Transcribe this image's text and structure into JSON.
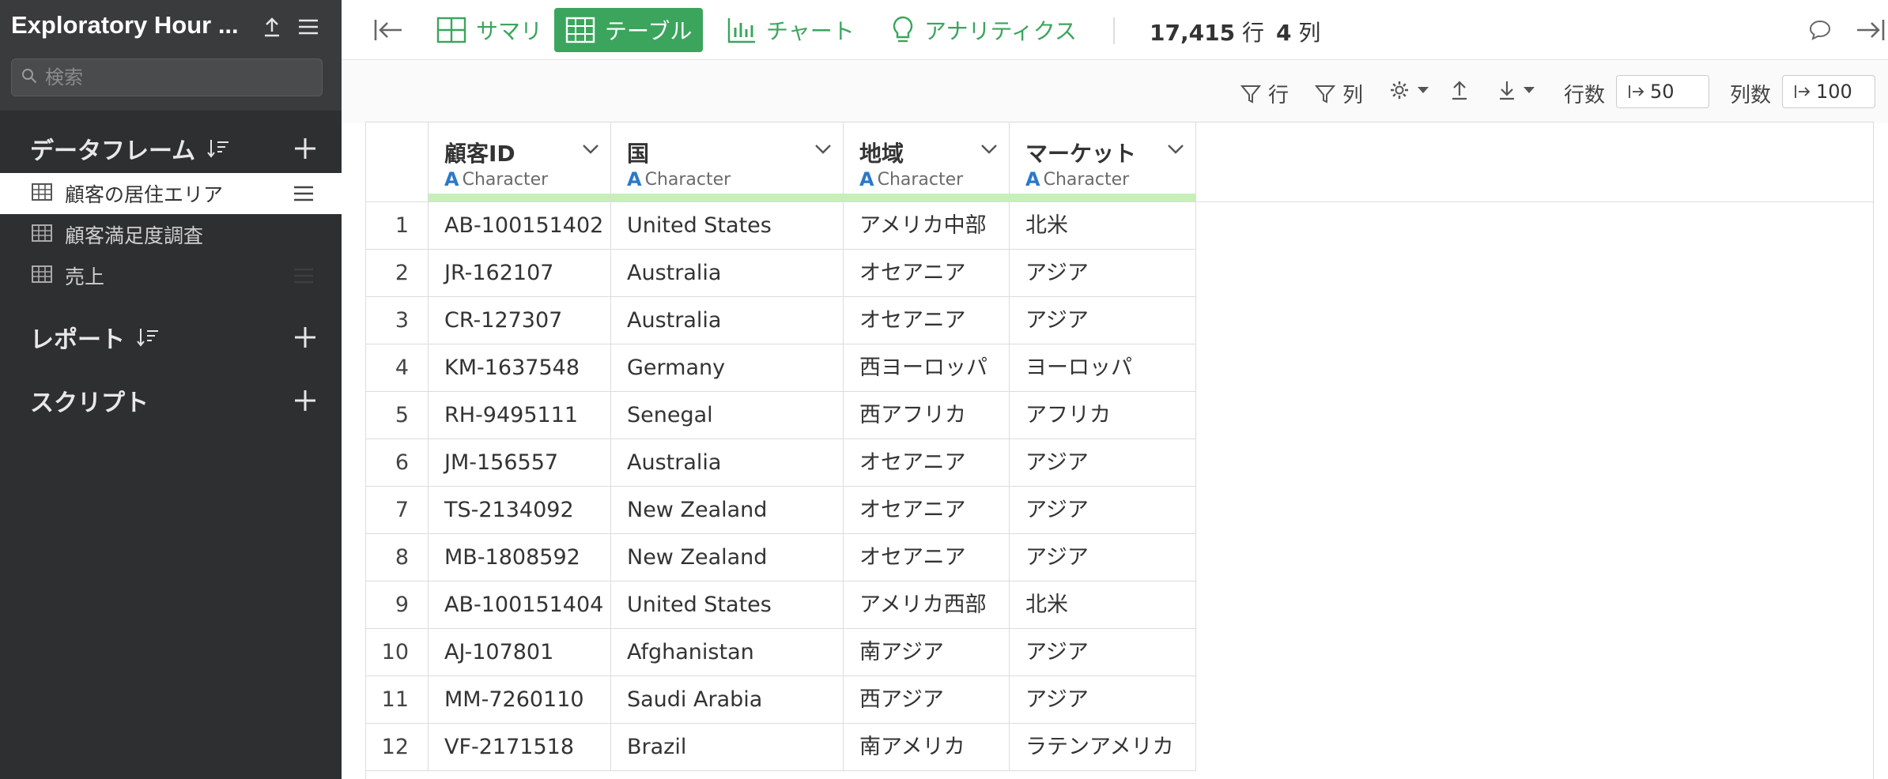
{
  "sidebar": {
    "project_title": "Exploratory Hour ...",
    "search_placeholder": "検索",
    "sections": {
      "dataframes": "データフレーム",
      "reports": "レポート",
      "scripts": "スクリプト"
    },
    "dataframes": [
      {
        "label": "顧客の居住エリア",
        "active": true
      },
      {
        "label": "顧客満足度調査",
        "active": false
      },
      {
        "label": "売上",
        "active": false
      }
    ]
  },
  "topbar": {
    "tabs": {
      "summary": "サマリ",
      "table": "テーブル",
      "chart": "チャート",
      "analytics": "アナリティクス"
    },
    "rows_count": "17,415",
    "rows_unit": "行",
    "cols_count": "4",
    "cols_unit": "列"
  },
  "toolbar": {
    "filter_rows": "行",
    "filter_cols": "列",
    "rows_label": "行数",
    "rows_value": "50",
    "cols_label": "列数",
    "cols_value": "100"
  },
  "table": {
    "columns": [
      {
        "name": "顧客ID",
        "type": "Character"
      },
      {
        "name": "国",
        "type": "Character"
      },
      {
        "name": "地域",
        "type": "Character"
      },
      {
        "name": "マーケット",
        "type": "Character"
      }
    ],
    "rows": [
      {
        "idx": "1",
        "c0": "AB-100151402",
        "c1": "United States",
        "c2": "アメリカ中部",
        "c3": "北米"
      },
      {
        "idx": "2",
        "c0": "JR-162107",
        "c1": "Australia",
        "c2": "オセアニア",
        "c3": "アジア"
      },
      {
        "idx": "3",
        "c0": "CR-127307",
        "c1": "Australia",
        "c2": "オセアニア",
        "c3": "アジア"
      },
      {
        "idx": "4",
        "c0": "KM-1637548",
        "c1": "Germany",
        "c2": "西ヨーロッパ",
        "c3": "ヨーロッパ"
      },
      {
        "idx": "5",
        "c0": "RH-9495111",
        "c1": "Senegal",
        "c2": "西アフリカ",
        "c3": "アフリカ"
      },
      {
        "idx": "6",
        "c0": "JM-156557",
        "c1": "Australia",
        "c2": "オセアニア",
        "c3": "アジア"
      },
      {
        "idx": "7",
        "c0": "TS-2134092",
        "c1": "New Zealand",
        "c2": "オセアニア",
        "c3": "アジア"
      },
      {
        "idx": "8",
        "c0": "MB-1808592",
        "c1": "New Zealand",
        "c2": "オセアニア",
        "c3": "アジア"
      },
      {
        "idx": "9",
        "c0": "AB-100151404",
        "c1": "United States",
        "c2": "アメリカ西部",
        "c3": "北米"
      },
      {
        "idx": "10",
        "c0": "AJ-107801",
        "c1": "Afghanistan",
        "c2": "南アジア",
        "c3": "アジア"
      },
      {
        "idx": "11",
        "c0": "MM-7260110",
        "c1": "Saudi Arabia",
        "c2": "西アジア",
        "c3": "アジア"
      },
      {
        "idx": "12",
        "c0": "VF-2171518",
        "c1": "Brazil",
        "c2": "南アメリカ",
        "c3": "ラテンアメリカ"
      }
    ]
  },
  "colors": {
    "accent": "#3ba55d",
    "sidebar_bg": "#2e2f31",
    "type_icon": "#2a79c9",
    "header_bar": "#c6f0b8"
  }
}
